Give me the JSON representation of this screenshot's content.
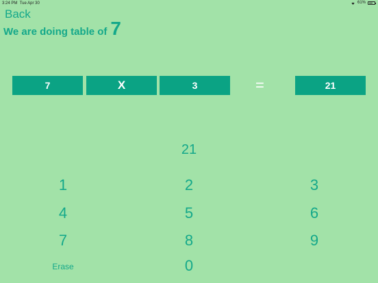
{
  "status_bar": {
    "time": "3:24 PM",
    "date": "Tue Apr 30",
    "battery": "61%"
  },
  "nav": {
    "back_label": "Back"
  },
  "heading": {
    "text": "We are doing table of",
    "number": "7"
  },
  "equation": {
    "left": "7",
    "operator": "X",
    "right": "3",
    "equals": "=",
    "result": "21"
  },
  "answer_display": "21",
  "keypad": {
    "row1": [
      "1",
      "2",
      "3"
    ],
    "row2": [
      "4",
      "5",
      "6"
    ],
    "row3": [
      "7",
      "8",
      "9"
    ],
    "erase": "Erase",
    "zero": "0"
  },
  "colors": {
    "background": "#a2e2a8",
    "accent": "#0ba384",
    "text": "#14a88a"
  }
}
